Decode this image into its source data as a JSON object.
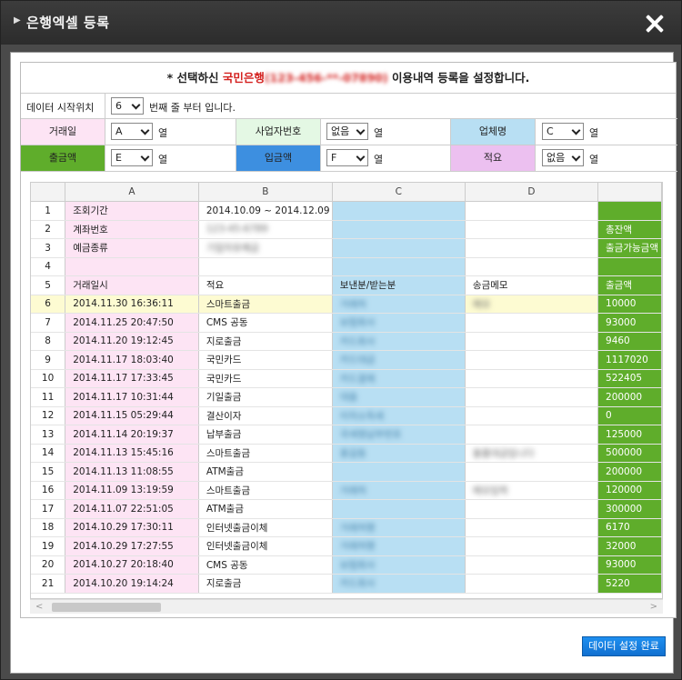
{
  "window": {
    "title": "은행엑셀 등록",
    "arrow_glyph": "▶",
    "close_glyph": ""
  },
  "header": {
    "prefix": "*  선택하신 ",
    "bank": "국민은행",
    "account_blurred": "(123-456-**-07890)",
    "suffix": " 이용내역 등록을 설정합니다."
  },
  "start_row": {
    "label": "데이터 시작위치",
    "value": "6",
    "after": "번째 줄 부터 입니다."
  },
  "mappings": [
    {
      "label": "거래일",
      "color": "#fde4f4",
      "value": "A",
      "unit": "열"
    },
    {
      "label": "사업자번호",
      "color": "#e4f8e4",
      "value": "없음",
      "unit": "열"
    },
    {
      "label": "업체명",
      "color": "#b8dff3",
      "value": "C",
      "unit": "열"
    },
    {
      "label": "출금액",
      "color": "#5fad2b",
      "value": "E",
      "unit": "열"
    },
    {
      "label": "입금액",
      "color": "#3d8fe0",
      "value": "F",
      "unit": "열"
    },
    {
      "label": "적요",
      "color": "#ecc0f0",
      "value": "없음",
      "unit": "열"
    }
  ],
  "grid": {
    "columns": [
      "A",
      "B",
      "C",
      "D",
      ""
    ],
    "rows": [
      {
        "n": "1",
        "a": "조회기간",
        "b": "2014.10.09  ~  2014.12.09",
        "c": "",
        "d": "",
        "e": ""
      },
      {
        "n": "2",
        "a": "계좌번호",
        "b": "123-45-6789",
        "c": "",
        "d": "",
        "e": "총잔액"
      },
      {
        "n": "3",
        "a": "예금종류",
        "b": "기업자유예금",
        "c": "",
        "d": "",
        "e": "출금가능금액"
      },
      {
        "n": "4",
        "a": "",
        "b": "",
        "c": "",
        "d": "",
        "e": ""
      },
      {
        "n": "5",
        "a": "거래일시",
        "b": "적요",
        "c": "보낸분/받는분",
        "d": "송금메모",
        "e": "출금액"
      },
      {
        "n": "6",
        "a": "2014.11.30 16:36:11",
        "b": "스마트출금",
        "c": "거래처",
        "d": "메모",
        "e": "10000"
      },
      {
        "n": "7",
        "a": "2014.11.25 20:47:50",
        "b": "CMS 공동",
        "c": "보험회사",
        "d": "",
        "e": "93000"
      },
      {
        "n": "8",
        "a": "2014.11.20 19:12:45",
        "b": "지로출금",
        "c": "카드회사",
        "d": "",
        "e": "9460"
      },
      {
        "n": "9",
        "a": "2014.11.17 18:03:40",
        "b": "국민카드",
        "c": "카드대금",
        "d": "",
        "e": "1117020"
      },
      {
        "n": "10",
        "a": "2014.11.17 17:33:45",
        "b": "국민카드",
        "c": "카드결제",
        "d": "",
        "e": "522405"
      },
      {
        "n": "11",
        "a": "2014.11.17 10:31:44",
        "b": "기일출금",
        "c": "대출",
        "d": "",
        "e": "200000"
      },
      {
        "n": "12",
        "a": "2014.11.15 05:29:44",
        "b": "결산이자",
        "c": "이자소득세",
        "d": "",
        "e": "0"
      },
      {
        "n": "13",
        "a": "2014.11.14 20:19:37",
        "b": "납부출금",
        "c": "국세청납부번호",
        "d": "",
        "e": "125000"
      },
      {
        "n": "14",
        "a": "2014.11.13 15:45:16",
        "b": "스마트출금",
        "c": "홍길동",
        "d": "물품대금입니다",
        "e": "500000"
      },
      {
        "n": "15",
        "a": "2014.11.13 11:08:55",
        "b": "ATM출금",
        "c": "",
        "d": "",
        "e": "200000"
      },
      {
        "n": "16",
        "a": "2014.11.09 13:19:59",
        "b": "스마트출금",
        "c": "거래처",
        "d": "메모입력",
        "e": "120000"
      },
      {
        "n": "17",
        "a": "2014.11.07 22:51:05",
        "b": "ATM출금",
        "c": "",
        "d": "",
        "e": "300000"
      },
      {
        "n": "18",
        "a": "2014.10.29 17:30:11",
        "b": "인터넷출금이체",
        "c": "거래처명",
        "d": "",
        "e": "6170"
      },
      {
        "n": "19",
        "a": "2014.10.29 17:27:55",
        "b": "인터넷출금이체",
        "c": "거래처명",
        "d": "",
        "e": "32000"
      },
      {
        "n": "20",
        "a": "2014.10.27 20:18:40",
        "b": "CMS 공동",
        "c": "보험회사",
        "d": "",
        "e": "93000"
      },
      {
        "n": "21",
        "a": "2014.10.20 19:14:24",
        "b": "지로출금",
        "c": "카드회사",
        "d": "",
        "e": "5220"
      }
    ]
  },
  "complete_button": "데이터 설정 완료",
  "scroll": {
    "left_glyph": "<",
    "right_glyph": ">"
  }
}
